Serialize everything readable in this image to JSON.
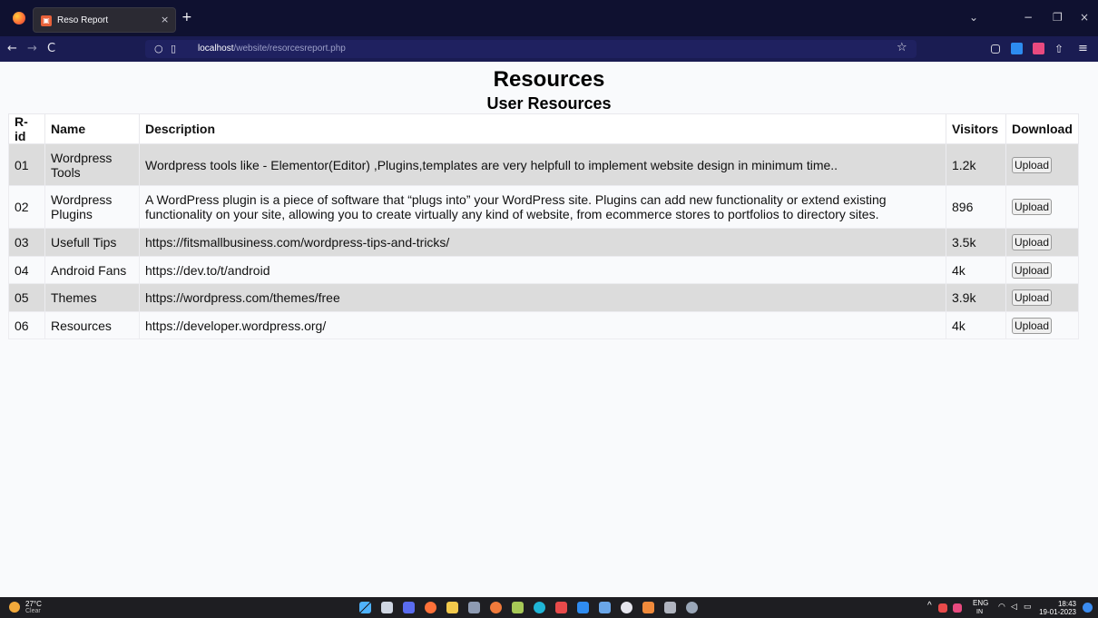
{
  "browser": {
    "tab_title": "Reso Report",
    "tab_close": "×",
    "new_tab": "+",
    "url_host": "localhost",
    "url_path": "/website/resorcesreport.php",
    "back": "←",
    "forward": "→",
    "reload": "C",
    "star": "☆",
    "list_tabs": "⌄",
    "minimize": "−",
    "maximize": "❐",
    "close": "×",
    "menu": "≡"
  },
  "page": {
    "title": "Resources",
    "subtitle": "User Resources"
  },
  "table": {
    "headers": [
      "R-id",
      "Name",
      "Description",
      "Visitors",
      "Download"
    ],
    "rows": [
      {
        "id": "01",
        "name": "Wordpress Tools",
        "description": "Wordpress tools like - Elementor(Editor) ,Plugins,templates are very helpfull to implement website design in minimum time..",
        "visitors": "1.2k",
        "button": "Upload"
      },
      {
        "id": "02",
        "name": "Wordpress Plugins",
        "description": "A WordPress plugin is a piece of software that “plugs into” your WordPress site. Plugins can add new functionality or extend existing functionality on your site, allowing you to create virtually any kind of website, from ecommerce stores to portfolios to directory sites.",
        "visitors": "896",
        "button": "Upload"
      },
      {
        "id": "03",
        "name": "Usefull Tips",
        "description": "https://fitsmallbusiness.com/wordpress-tips-and-tricks/",
        "visitors": "3.5k",
        "button": "Upload"
      },
      {
        "id": "04",
        "name": "Android Fans",
        "description": "https://dev.to/t/android",
        "visitors": "4k",
        "button": "Upload"
      },
      {
        "id": "05",
        "name": "Themes",
        "description": "https://wordpress.com/themes/free",
        "visitors": "3.9k",
        "button": "Upload"
      },
      {
        "id": "06",
        "name": "Resources",
        "description": "https://developer.wordpress.org/",
        "visitors": "4k",
        "button": "Upload"
      }
    ]
  },
  "taskbar": {
    "temperature": "27°C",
    "weather": "Clear",
    "lang": "ENG",
    "region": "IN",
    "time": "18:43",
    "date": "19-01-2023"
  },
  "colors": {
    "row_odd": "#dcdcdc",
    "row_even": "#f9fafc",
    "chrome_nav": "#1a1c52"
  }
}
